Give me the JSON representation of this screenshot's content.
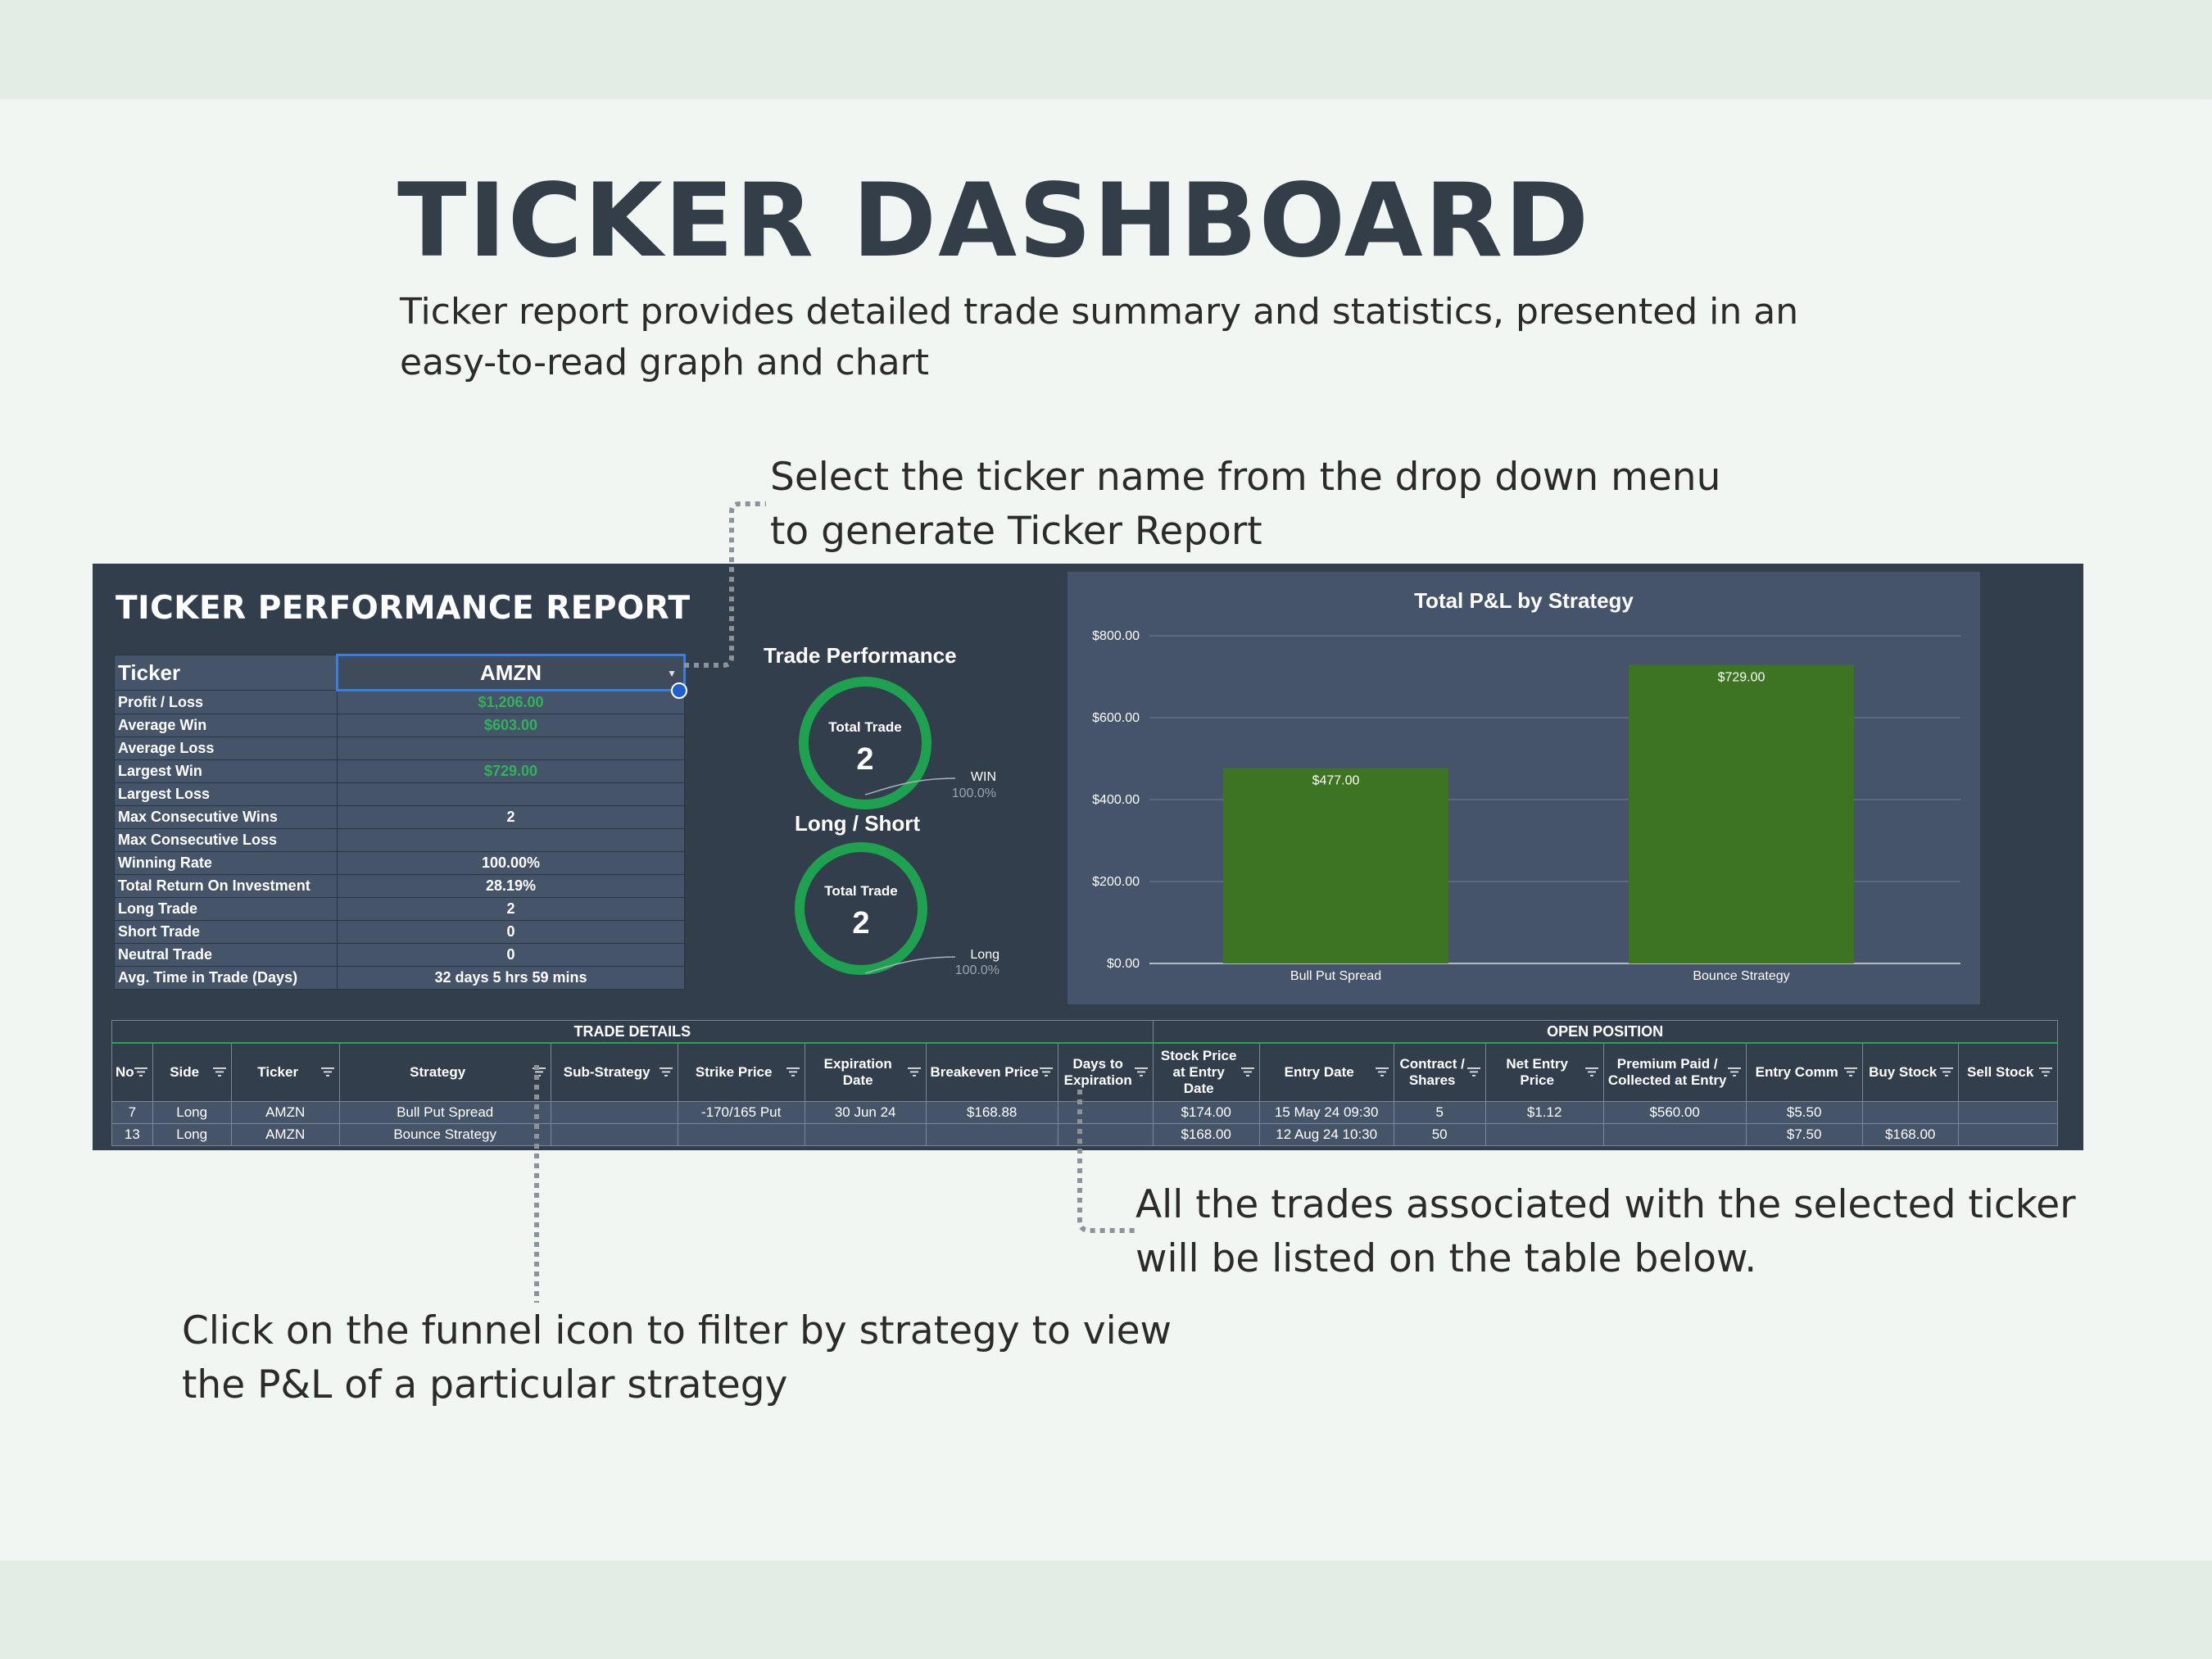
{
  "page": {
    "title": "TICKER DASHBOARD",
    "subtitle": "Ticker report provides detailed trade summary and statistics, presented in an easy-to-read graph and chart",
    "callout_dropdown": "Select the ticker name from the drop down menu to generate Ticker Report",
    "callout_table": "All the trades associated with the selected ticker will be listed on the table below.",
    "callout_filter": "Click on the funnel icon to filter by strategy to view the P&L of a particular strategy"
  },
  "report": {
    "title": "TICKER PERFORMANCE REPORT",
    "ticker_label": "Ticker",
    "ticker_value": "AMZN",
    "stats": [
      {
        "label": "Profit / Loss",
        "value": "$1,206.00",
        "green": true
      },
      {
        "label": "Average Win",
        "value": "$603.00",
        "green": true
      },
      {
        "label": "Average Loss",
        "value": "",
        "green": false
      },
      {
        "label": "Largest Win",
        "value": "$729.00",
        "green": true
      },
      {
        "label": "Largest Loss",
        "value": "",
        "green": false
      },
      {
        "label": "Max Consecutive Wins",
        "value": "2",
        "green": false
      },
      {
        "label": "Max Consecutive Loss",
        "value": "",
        "green": false
      },
      {
        "label": "Winning Rate",
        "value": "100.00%",
        "green": false
      },
      {
        "label": "Total Return On Investment",
        "value": "28.19%",
        "green": false
      },
      {
        "label": "Long Trade",
        "value": "2",
        "green": false
      },
      {
        "label": "Short Trade",
        "value": "0",
        "green": false
      },
      {
        "label": "Neutral Trade",
        "value": "0",
        "green": false
      },
      {
        "label": "Avg. Time in Trade (Days)",
        "value": "32 days 5 hrs 59 mins",
        "green": false
      }
    ],
    "trade_performance": {
      "title": "Trade Performance",
      "center_label": "Total Trade",
      "center_value": "2",
      "legend_name": "WIN",
      "legend_pct": "100.0%",
      "fraction": 1.0
    },
    "long_short": {
      "title": "Long  / Short",
      "center_label": "Total Trade",
      "center_value": "2",
      "legend_name": "Long",
      "legend_pct": "100.0%",
      "fraction": 1.0
    }
  },
  "colors": {
    "panel": "#333e4c",
    "chart_bg": "#45546a",
    "bar": "#3d7421",
    "donut": "#1ea24f",
    "positive": "#2fb35a"
  },
  "chart_data": {
    "type": "bar",
    "title": "Total P&L by Strategy",
    "categories": [
      "Bull Put Spread",
      "Bounce Strategy"
    ],
    "values": [
      477.0,
      729.0
    ],
    "data_labels": [
      "$477.00",
      "$729.00"
    ],
    "ylim": [
      0,
      800
    ],
    "y_ticks": [
      "$0.00",
      "$200.00",
      "$400.00",
      "$600.00",
      "$800.00"
    ],
    "y_tick_values": [
      0,
      200,
      400,
      600,
      800
    ],
    "grid": true,
    "xlabel": "",
    "ylabel": ""
  },
  "trade_table": {
    "group_trade_details": "TRADE DETAILS",
    "group_open_position": "OPEN POSITION",
    "columns": [
      "No",
      "Side",
      "Ticker",
      "Strategy",
      "Sub-Strategy",
      "Strike Price",
      "Expiration Date",
      "Breakeven Price",
      "Days to Expiration",
      "Stock Price at Entry Date",
      "Entry Date",
      "Contract / Shares",
      "Net Entry Price",
      "Premium Paid / Collected at Entry",
      "Entry Comm",
      "Buy Stock",
      "Sell Stock"
    ],
    "rows": [
      [
        "7",
        "Long",
        "AMZN",
        "Bull Put Spread",
        "",
        "-170/165 Put",
        "30 Jun 24",
        "$168.88",
        "",
        "$174.00",
        "15 May 24 09:30",
        "5",
        "$1.12",
        "$560.00",
        "$5.50",
        "",
        ""
      ],
      [
        "13",
        "Long",
        "AMZN",
        "Bounce Strategy",
        "",
        "",
        "",
        "",
        "",
        "$168.00",
        "12 Aug 24 10:30",
        "50",
        "",
        "",
        "$7.50",
        "$168.00",
        ""
      ]
    ]
  }
}
